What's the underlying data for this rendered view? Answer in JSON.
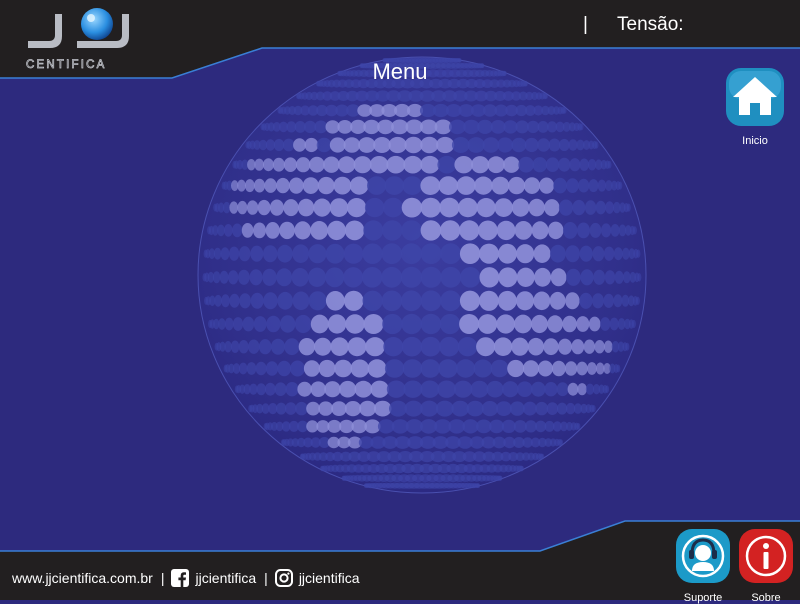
{
  "header": {
    "logo_text": "CENTIFICA",
    "separator": "|",
    "tensao_label": "Tensão:"
  },
  "main": {
    "title": "Menu"
  },
  "nav": {
    "home_label": "Inicio",
    "support_label": "Suporte",
    "about_label": "Sobre"
  },
  "footer": {
    "website": "www.jjcientifica.com.br",
    "separator": "|",
    "facebook": "jjcientifica",
    "instagram": "jjcientifica"
  },
  "colors": {
    "background": "#2d2a7e",
    "header_bg": "#221f20",
    "accent_line": "#3a7fd5",
    "home_button": "#1f8fc0",
    "support_button": "#1c9ac8",
    "about_button": "#d32222"
  },
  "icons": {
    "home": "house-icon",
    "support": "headset-icon",
    "about": "info-icon",
    "facebook": "facebook-icon",
    "instagram": "instagram-icon",
    "globe": "dotted-globe-icon"
  }
}
